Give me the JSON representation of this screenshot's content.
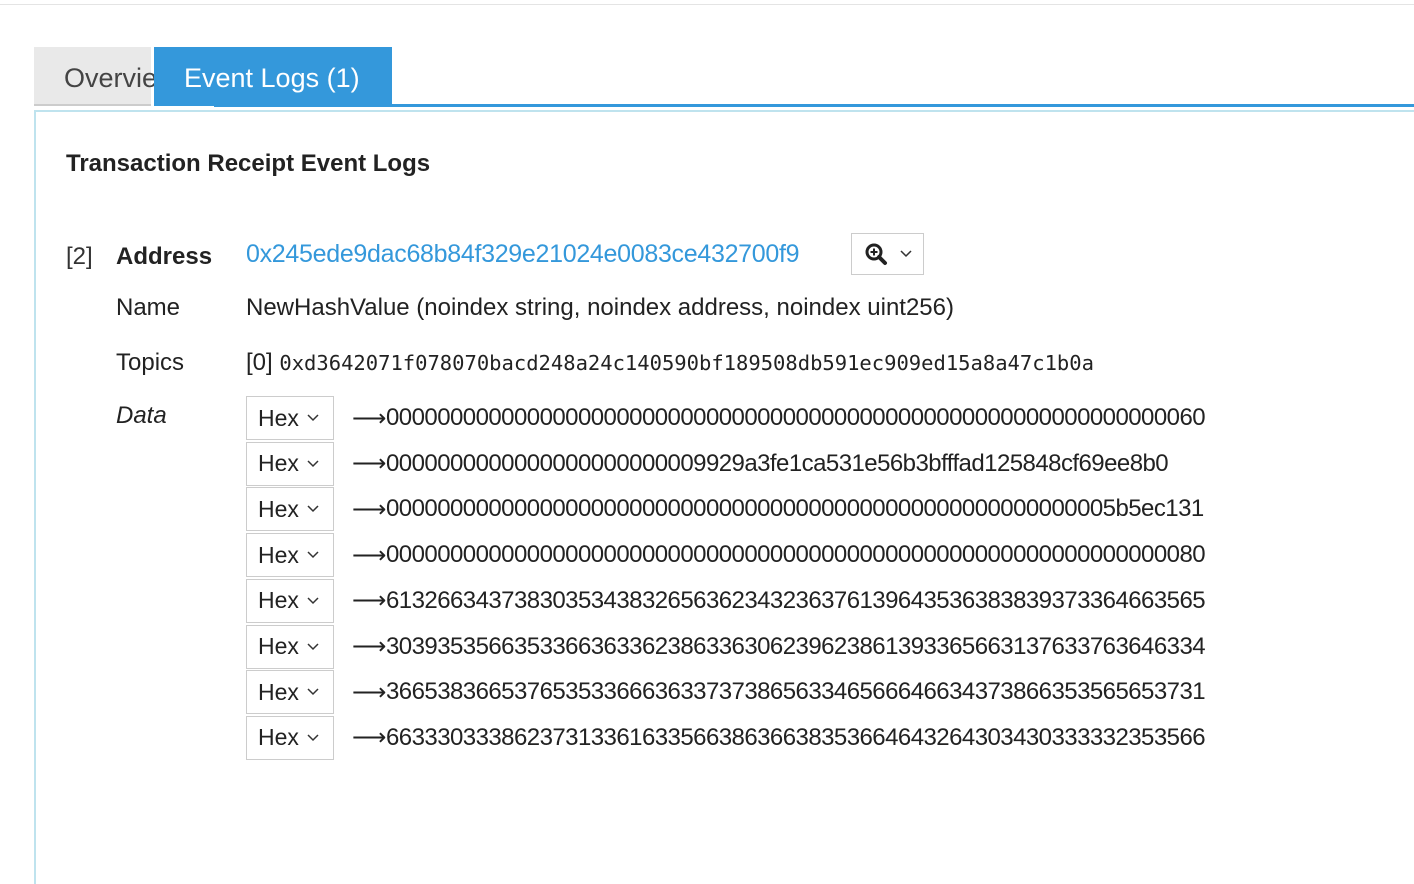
{
  "tabs": [
    {
      "label": "Overview"
    },
    {
      "label": "Event Logs (1)"
    }
  ],
  "section_title": "Transaction Receipt Event Logs",
  "log": {
    "index": "[2]",
    "address_label": "Address",
    "address": "0x245ede9dac68b84f329e21024e0083ce432700f9",
    "name_label": "Name",
    "name": "NewHashValue (noindex string, noindex address, noindex uint256)",
    "topics_label": "Topics",
    "topics": [
      {
        "index": "[0]",
        "value": "0xd3642071f078070bacd248a24c140590bf189508db591ec909ed15a8a47c1b0a"
      }
    ],
    "data_label": "Data",
    "data": [
      {
        "format": "Hex",
        "value": "0000000000000000000000000000000000000000000000000000000000000060"
      },
      {
        "format": "Hex",
        "value": "0000000000000000000000009929a3fe1ca531e56b3bfffad125848cf69ee8b0"
      },
      {
        "format": "Hex",
        "value": "000000000000000000000000000000000000000000000000000000005b5ec131"
      },
      {
        "format": "Hex",
        "value": "0000000000000000000000000000000000000000000000000000000000000080"
      },
      {
        "format": "Hex",
        "value": "6132663437383035343832656362343236376139643536383839373364663565"
      },
      {
        "format": "Hex",
        "value": "3039353566353366363362386336306239623861393365663137633763646334"
      },
      {
        "format": "Hex",
        "value": "3665383665376535336663633737386563346566646634373866353565653731"
      },
      {
        "format": "Hex",
        "value": "6633303338623731336163356638636638353664643264303430333332353566"
      }
    ]
  },
  "icons": {
    "zoom": "magnifier-plus-icon",
    "chevron": "chevron-down-icon",
    "arrow": "right-arrow-icon"
  },
  "colors": {
    "accent": "#3498db"
  }
}
